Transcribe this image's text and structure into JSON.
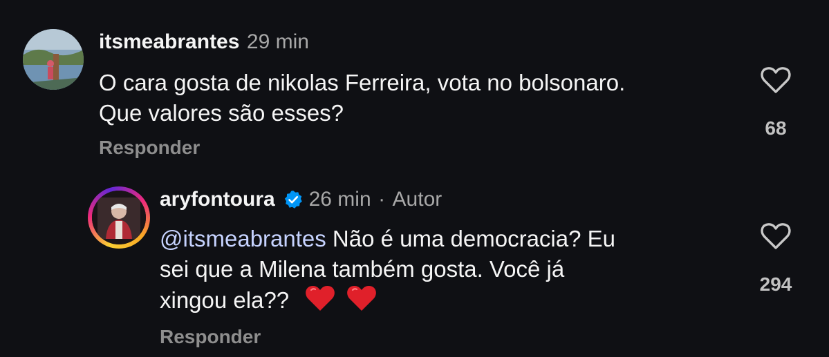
{
  "comments": [
    {
      "username": "itsmeabrantes",
      "time": "29 min",
      "text_line1": "O cara gosta de nikolas Ferreira, vota no bolsonaro.",
      "text_line2": "Que valores são esses?",
      "like_count": "68",
      "reply_label": "Responder",
      "avatar_icon": "landscape-photo-avatar"
    },
    {
      "username": "aryfontoura",
      "verified": true,
      "time": "26 min",
      "separator": "·",
      "author_tag": "Autor",
      "mention": "@itsmeabrantes",
      "text_part1": " Não é uma democracia? Eu",
      "text_line2": "sei que a Milena também gosta. Você já",
      "text_line3": "xingou ela??",
      "emojis": [
        "red-heart-emoji",
        "red-heart-emoji"
      ],
      "like_count": "294",
      "reply_label": "Responder",
      "avatar_icon": "person-photo-avatar-with-story-ring"
    }
  ],
  "colors": {
    "background": "#0f1014",
    "text": "#f5f5f5",
    "muted": "#a8a8a8",
    "mention": "#c6d3ff",
    "verified": "#0095f6"
  }
}
